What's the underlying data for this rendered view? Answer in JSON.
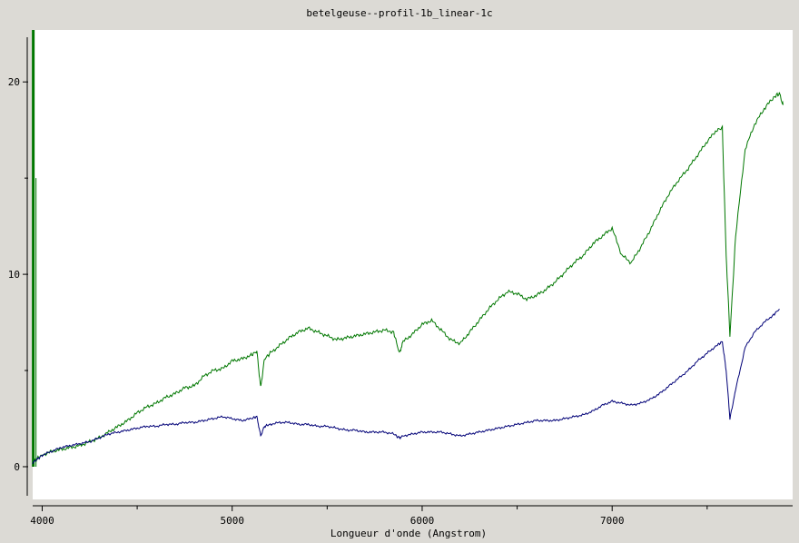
{
  "chart_data": {
    "type": "line",
    "title": "betelgeuse--profil-1b_linear-1c",
    "xlabel": "Longueur d'onde (Angstrom)",
    "ylabel": "",
    "xlim": [
      3950,
      7950
    ],
    "ylim": [
      -1.7,
      22.7
    ],
    "x_ticks": [
      4000,
      5000,
      6000,
      7000
    ],
    "x_minor_ticks": [
      4500,
      5500,
      6500,
      7500
    ],
    "y_ticks": [
      0,
      10,
      20
    ],
    "y_minor_ticks": [
      5,
      15
    ],
    "grid": false,
    "background": "#ffffff",
    "series": [
      {
        "color": "#007700",
        "x": [
          3950,
          3960,
          3970,
          4000,
          4050,
          4100,
          4150,
          4200,
          4250,
          4300,
          4350,
          4400,
          4450,
          4500,
          4550,
          4600,
          4650,
          4700,
          4750,
          4800,
          4850,
          4900,
          4950,
          5000,
          5050,
          5100,
          5130,
          5150,
          5170,
          5200,
          5250,
          5300,
          5350,
          5400,
          5450,
          5500,
          5550,
          5600,
          5650,
          5700,
          5750,
          5800,
          5850,
          5880,
          5900,
          5950,
          6000,
          6050,
          6100,
          6150,
          6200,
          6250,
          6300,
          6350,
          6400,
          6450,
          6500,
          6550,
          6600,
          6650,
          6700,
          6750,
          6800,
          6850,
          6900,
          6950,
          7000,
          7050,
          7100,
          7150,
          7200,
          7250,
          7300,
          7350,
          7400,
          7450,
          7500,
          7550,
          7580,
          7600,
          7620,
          7650,
          7700,
          7750,
          7800,
          7850,
          7880,
          7900
        ],
        "y": [
          0.2,
          0.3,
          0.4,
          0.6,
          0.8,
          0.9,
          1.0,
          1.1,
          1.3,
          1.5,
          1.8,
          2.1,
          2.4,
          2.8,
          3.1,
          3.3,
          3.6,
          3.8,
          4.1,
          4.2,
          4.7,
          5.0,
          5.1,
          5.5,
          5.6,
          5.8,
          6.0,
          4.1,
          5.6,
          5.9,
          6.3,
          6.7,
          7.0,
          7.2,
          7.0,
          6.8,
          6.6,
          6.7,
          6.8,
          6.9,
          7.0,
          7.1,
          7.0,
          5.9,
          6.5,
          6.9,
          7.4,
          7.6,
          7.1,
          6.6,
          6.4,
          7.0,
          7.6,
          8.2,
          8.7,
          9.1,
          9.0,
          8.7,
          8.9,
          9.2,
          9.6,
          10.1,
          10.6,
          11.0,
          11.6,
          12.0,
          12.4,
          11.0,
          10.6,
          11.4,
          12.3,
          13.3,
          14.2,
          14.9,
          15.5,
          16.2,
          16.9,
          17.5,
          17.6,
          11.0,
          6.8,
          12.0,
          16.5,
          17.8,
          18.6,
          19.2,
          19.4,
          18.8
        ]
      },
      {
        "color": "#000077",
        "x": [
          3950,
          3975,
          4000,
          4050,
          4100,
          4150,
          4200,
          4250,
          4300,
          4350,
          4400,
          4450,
          4500,
          4550,
          4600,
          4650,
          4700,
          4750,
          4800,
          4850,
          4900,
          4950,
          5000,
          5050,
          5100,
          5130,
          5150,
          5170,
          5200,
          5250,
          5300,
          5350,
          5400,
          5450,
          5500,
          5550,
          5600,
          5650,
          5700,
          5750,
          5800,
          5850,
          5880,
          5900,
          5950,
          6000,
          6050,
          6100,
          6150,
          6200,
          6250,
          6300,
          6350,
          6400,
          6450,
          6500,
          6550,
          6600,
          6650,
          6700,
          6750,
          6800,
          6850,
          6900,
          6950,
          7000,
          7050,
          7100,
          7150,
          7200,
          7250,
          7300,
          7350,
          7400,
          7450,
          7500,
          7550,
          7580,
          7600,
          7620,
          7650,
          7700,
          7750,
          7800,
          7850,
          7880
        ],
        "y": [
          0.2,
          0.4,
          0.6,
          0.8,
          1.0,
          1.1,
          1.2,
          1.3,
          1.5,
          1.7,
          1.8,
          1.9,
          2.0,
          2.1,
          2.1,
          2.2,
          2.2,
          2.3,
          2.3,
          2.4,
          2.5,
          2.6,
          2.5,
          2.4,
          2.5,
          2.6,
          1.6,
          2.1,
          2.2,
          2.3,
          2.3,
          2.2,
          2.2,
          2.1,
          2.1,
          2.0,
          1.9,
          1.9,
          1.8,
          1.8,
          1.8,
          1.7,
          1.5,
          1.6,
          1.7,
          1.8,
          1.8,
          1.8,
          1.7,
          1.6,
          1.7,
          1.8,
          1.9,
          2.0,
          2.1,
          2.2,
          2.3,
          2.4,
          2.4,
          2.4,
          2.5,
          2.6,
          2.7,
          2.9,
          3.2,
          3.4,
          3.3,
          3.2,
          3.3,
          3.5,
          3.8,
          4.2,
          4.6,
          5.0,
          5.5,
          5.9,
          6.3,
          6.5,
          5.0,
          2.5,
          4.0,
          6.2,
          7.0,
          7.5,
          7.9,
          8.2
        ]
      }
    ],
    "marker_line": {
      "color": "#007700",
      "x": 3953,
      "y_top": 22.7,
      "y_bottom": 0
    }
  }
}
